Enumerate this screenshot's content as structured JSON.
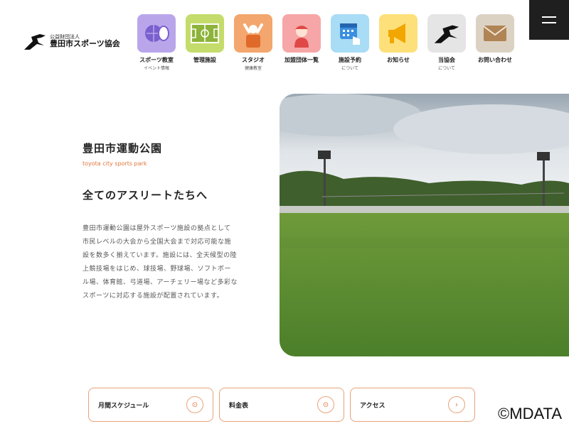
{
  "logo": {
    "sub": "公益財団法人",
    "main": "豊田市スポーツ協会"
  },
  "nav": [
    {
      "label": "スポーツ教室",
      "sub": "イベント情報",
      "color": "#b9a6ea",
      "icon": "sports-ball-icon"
    },
    {
      "label": "管理施設",
      "sub": "",
      "color": "#c4dc6b",
      "icon": "field-icon"
    },
    {
      "label": "スタジオ",
      "sub": "健康教室",
      "color": "#f3a66d",
      "icon": "exercise-person-icon"
    },
    {
      "label": "加盟団体一覧",
      "sub": "",
      "color": "#f6a6a6",
      "icon": "person-icon"
    },
    {
      "label": "施設予約",
      "sub": "について",
      "color": "#a9dcf5",
      "icon": "calendar-hand-icon"
    },
    {
      "label": "お知らせ",
      "sub": "",
      "color": "#fde07a",
      "icon": "megaphone-icon"
    },
    {
      "label": "当協会",
      "sub": "について",
      "color": "#e5e5e5",
      "icon": "runner-logo-icon"
    },
    {
      "label": "お問い合わせ",
      "sub": "",
      "color": "#dcd2c4",
      "icon": "envelope-icon"
    }
  ],
  "hero": {
    "title": "豊田市運動公園",
    "subtitle": "toyota city sports park",
    "heading": "全てのアスリートたちへ",
    "body": "豊田市運動公園は屋外スポーツ施設の拠点として市民レベルの大会から全国大会まで対応可能な施設を数多く揃えています。施設には、全天候型の陸上競技場をはじめ、球技場、野球場、ソフトボール場、体育館、弓道場、アーチェリー場など多彩なスポーツに対応する施設が配置されています。"
  },
  "cards": [
    {
      "label": "月間スケジュール",
      "icon": "calendar-link-icon"
    },
    {
      "label": "料金表",
      "icon": "link-icon"
    },
    {
      "label": "アクセス",
      "icon": "arrow-icon"
    }
  ],
  "watermark": "©MDATA",
  "colors": {
    "accent": "#e0753a",
    "menu": "#1f1f1f"
  }
}
